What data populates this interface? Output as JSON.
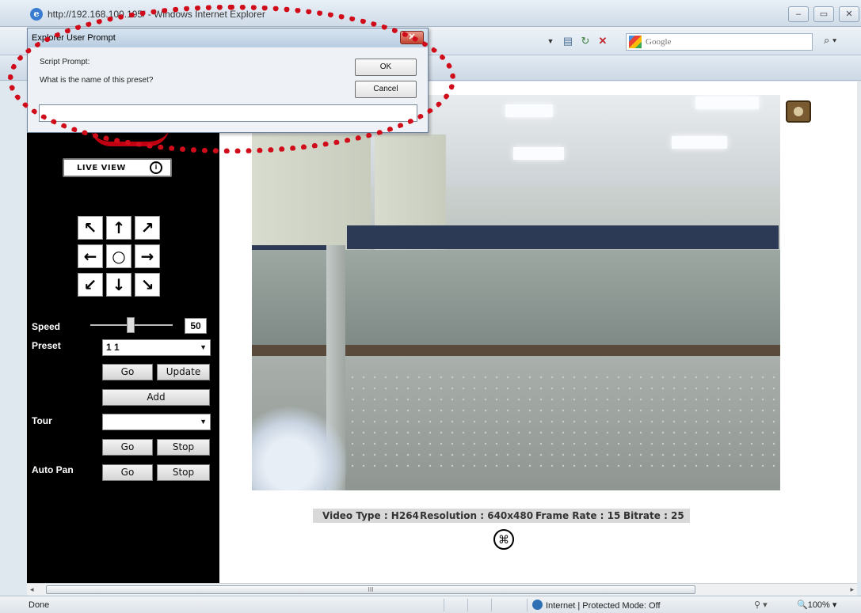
{
  "window": {
    "title": "http://192.168.100.195/ - Windows Internet Explorer",
    "controls": {
      "minimize": "–",
      "restore": "▭",
      "close": "✕"
    }
  },
  "toolbar": {
    "search_placeholder": "Google",
    "icons": [
      "page-icon",
      "refresh-icon",
      "stop-icon",
      "search-icon"
    ]
  },
  "dialog": {
    "title": "Explorer User Prompt",
    "close": "✕",
    "prompt_title": "Script Prompt:",
    "question": "What is the name of this preset?",
    "ok": "OK",
    "cancel": "Cancel",
    "input_value": ""
  },
  "panel": {
    "live_view": "LIVE VIEW",
    "ptz": {
      "up_left": "↖",
      "up": "↑",
      "up_right": "↗",
      "left": "←",
      "home": "○",
      "right": "→",
      "down_left": "↙",
      "down": "↓",
      "down_right": "↘"
    },
    "speed_label": "Speed",
    "speed_value": "50",
    "speed_fraction": 0.5,
    "preset_label": "Preset",
    "preset_value": "1 1",
    "preset_go": "Go",
    "preset_update": "Update",
    "preset_add": "Add",
    "tour_label": "Tour",
    "tour_value": "",
    "tour_go": "Go",
    "tour_stop": "Stop",
    "autopan_label": "Auto Pan",
    "autopan_go": "Go",
    "autopan_stop": "Stop"
  },
  "video_info": {
    "video_type": "Video Type : H264",
    "resolution": "Resolution : 640x480",
    "frame_rate": "Frame Rate : 15",
    "bitrate": "Bitrate : 25"
  },
  "scroll": {
    "left": "◂",
    "grip": "III",
    "right": "▸"
  },
  "status": {
    "text": "Done",
    "zone": "Internet | Protected Mode: Off",
    "misc": "⚲ ▾",
    "zoom": "🔍100%  ▾"
  }
}
